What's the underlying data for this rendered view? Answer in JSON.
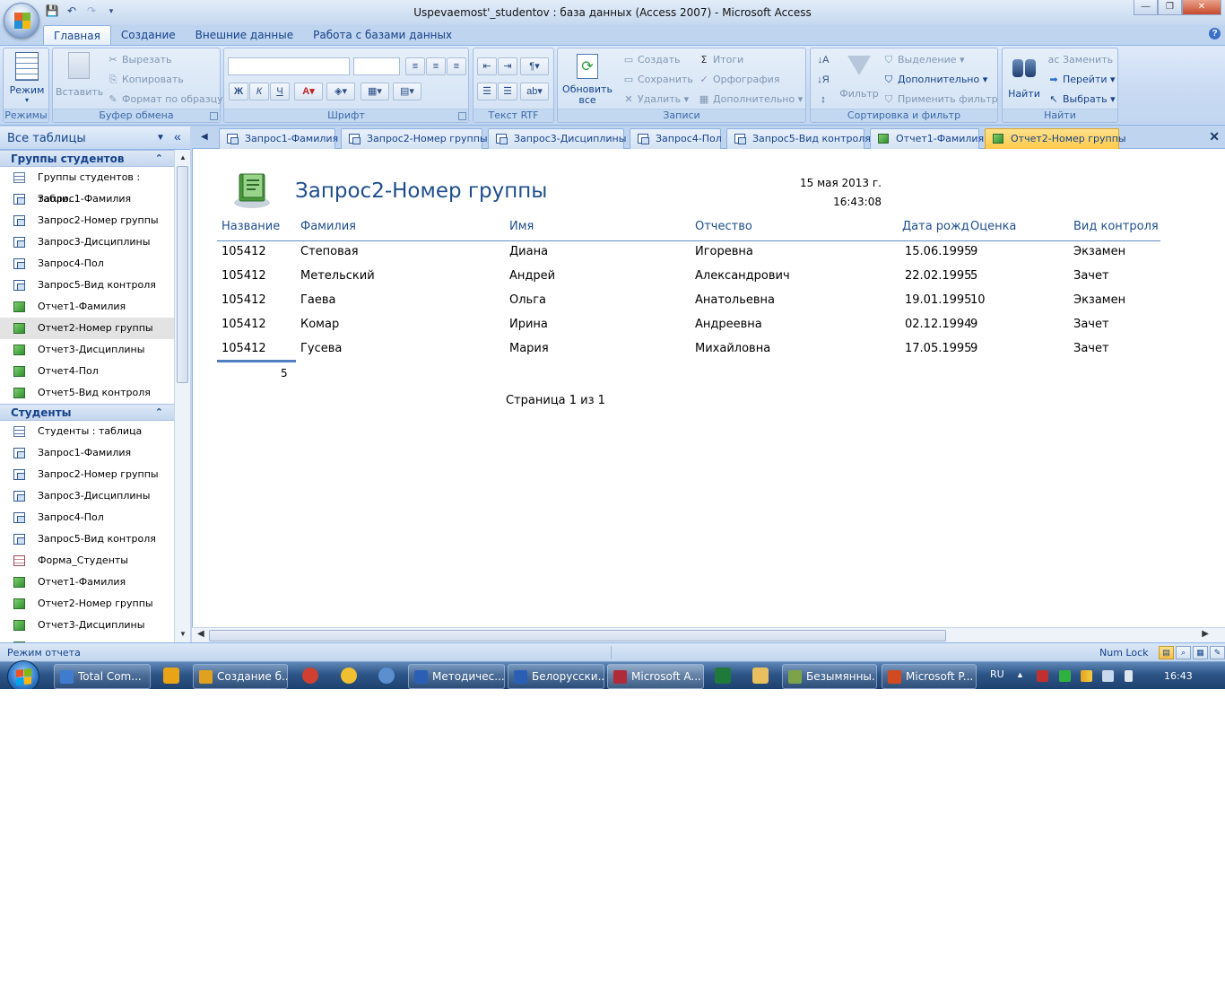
{
  "window": {
    "title": "Uspevaemost'_studentov : база данных (Access 2007) - Microsoft Access"
  },
  "ribbon_tabs": [
    "Главная",
    "Создание",
    "Внешние данные",
    "Работа с базами данных"
  ],
  "ribbon": {
    "modes": {
      "view_label": "Режим",
      "group": "Режимы"
    },
    "clipboard": {
      "paste": "Вставить",
      "cut": "Вырезать",
      "copy": "Копировать",
      "format_painter": "Формат по образцу",
      "group": "Буфер обмена"
    },
    "font": {
      "bold": "Ж",
      "italic": "К",
      "underline": "Ч",
      "group": "Шрифт"
    },
    "rtf": {
      "group": "Текст RTF"
    },
    "records": {
      "refresh": "Обновить все",
      "new": "Создать",
      "save": "Сохранить",
      "delete": "Удалить",
      "totals": "Итоги",
      "spelling": "Орфография",
      "more": "Дополнительно",
      "group": "Записи"
    },
    "sort": {
      "filter": "Фильтр",
      "selection": "Выделение",
      "advanced": "Дополнительно",
      "toggle": "Применить фильтр",
      "group": "Сортировка и фильтр"
    },
    "find": {
      "find": "Найти",
      "replace": "Заменить",
      "goto": "Перейти",
      "select": "Выбрать",
      "group": "Найти"
    }
  },
  "nav": {
    "title": "Все таблицы",
    "sections": [
      {
        "name": "Группы студентов",
        "items": [
          {
            "label": "Группы студентов : табли...",
            "type": "tbl"
          },
          {
            "label": "Запрос1-Фамилия",
            "type": "qry"
          },
          {
            "label": "Запрос2-Номер группы",
            "type": "qry"
          },
          {
            "label": "Запрос3-Дисциплины",
            "type": "qry"
          },
          {
            "label": "Запрос4-Пол",
            "type": "qry"
          },
          {
            "label": "Запрос5-Вид контроля",
            "type": "qry"
          },
          {
            "label": "Отчет1-Фамилия",
            "type": "rpt"
          },
          {
            "label": "Отчет2-Номер группы",
            "type": "rpt"
          },
          {
            "label": "Отчет3-Дисциплины",
            "type": "rpt"
          },
          {
            "label": "Отчет4-Пол",
            "type": "rpt"
          },
          {
            "label": "Отчет5-Вид контроля",
            "type": "rpt"
          }
        ]
      },
      {
        "name": "Студенты",
        "items": [
          {
            "label": "Студенты : таблица",
            "type": "tbl"
          },
          {
            "label": "Запрос1-Фамилия",
            "type": "qry"
          },
          {
            "label": "Запрос2-Номер группы",
            "type": "qry"
          },
          {
            "label": "Запрос3-Дисциплины",
            "type": "qry"
          },
          {
            "label": "Запрос4-Пол",
            "type": "qry"
          },
          {
            "label": "Запрос5-Вид контроля",
            "type": "qry"
          },
          {
            "label": "Форма_Студенты",
            "type": "frm"
          },
          {
            "label": "Отчет1-Фамилия",
            "type": "rpt"
          },
          {
            "label": "Отчет2-Номер группы",
            "type": "rpt"
          },
          {
            "label": "Отчет3-Дисциплины",
            "type": "rpt"
          },
          {
            "label": "",
            "type": "rpt"
          }
        ]
      }
    ]
  },
  "doc_tabs": [
    {
      "label": "Запрос1-Фамилия",
      "type": "qry"
    },
    {
      "label": "Запрос2-Номер группы",
      "type": "qry"
    },
    {
      "label": "Запрос3-Дисциплины",
      "type": "qry"
    },
    {
      "label": "Запрос4-Пол",
      "type": "qry"
    },
    {
      "label": "Запрос5-Вид контроля",
      "type": "qry"
    },
    {
      "label": "Отчет1-Фамилия",
      "type": "rpt"
    },
    {
      "label": "Отчет2-Номер группы",
      "type": "rpt",
      "active": true
    }
  ],
  "report": {
    "title": "Запрос2-Номер группы",
    "date": "15 мая 2013 г.",
    "time": "16:43:08",
    "columns": [
      "Название",
      "Фамилия",
      "Имя",
      "Отчество",
      "Дата рожд",
      "Оценка",
      "Вид контроля"
    ],
    "rows": [
      [
        "105412",
        "Степовая",
        "Диана",
        "Игоревна",
        "15.06.1995",
        "9",
        "Экзамен"
      ],
      [
        "105412",
        "Метельский",
        "Андрей",
        "Александрович",
        "22.02.1995",
        "5",
        "Зачет"
      ],
      [
        "105412",
        "Гаева",
        "Ольга",
        "Анатольевна",
        "19.01.1995",
        "10",
        "Экзамен"
      ],
      [
        "105412",
        "Комар",
        "Ирина",
        "Андреевна",
        "02.12.1994",
        "9",
        "Зачет"
      ],
      [
        "105412",
        "Гусева",
        "Мария",
        "Михайловна",
        "17.05.1995",
        "9",
        "Зачет"
      ]
    ],
    "count": "5",
    "page": "Страница 1 из 1"
  },
  "status": {
    "mode": "Режим отчета",
    "numlock": "Num Lock"
  },
  "taskbar": {
    "buttons": [
      {
        "label": "Total Com...",
        "icon_color": "#3f7ccf"
      },
      {
        "label": "Создание б...",
        "icon_color": "#e0a020"
      },
      {
        "label": "Методичес...",
        "icon_color": "#2b5fb5"
      },
      {
        "label": "Белорусски...",
        "icon_color": "#2b5fb5"
      },
      {
        "label": "Microsoft A...",
        "icon_color": "#b02a3a"
      },
      {
        "label": "Безымянны...",
        "icon_color": "#7da34a"
      },
      {
        "label": "Microsoft P...",
        "icon_color": "#d24a1f"
      }
    ],
    "lang": "RU",
    "clock": "16:43"
  },
  "colors": {
    "accent": "#15428b",
    "active_tab": "#ffc94a",
    "report_title": "#1f4e8c"
  }
}
